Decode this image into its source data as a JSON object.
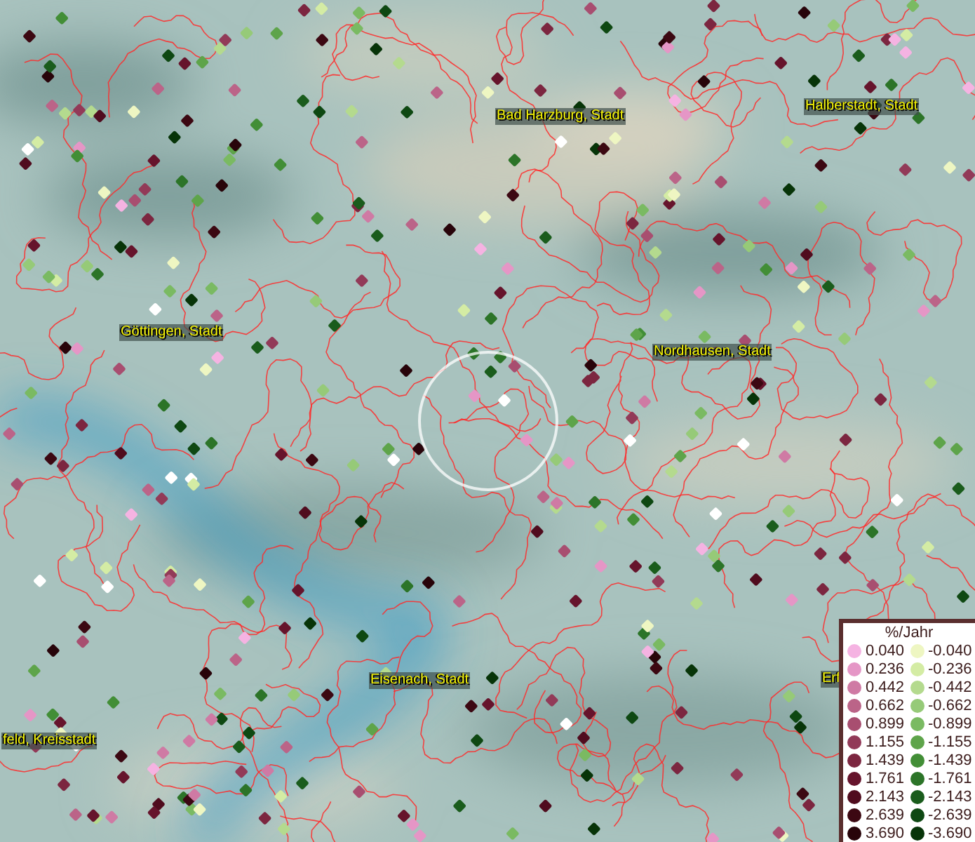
{
  "map_labels": [
    {
      "text": "Bad Harzburg, Stadt"
    },
    {
      "text": "Halberstadt, Stadt"
    },
    {
      "text": "Göttingen, Stadt"
    },
    {
      "text": "Nordhausen, Stadt"
    },
    {
      "text": "Eisenach, Stadt"
    },
    {
      "text": "feld, Kreisstadt"
    },
    {
      "text": "Erf"
    }
  ],
  "legend": {
    "title": "%/Jahr",
    "positive": [
      {
        "label": "0.040",
        "color": "#f5b3e2"
      },
      {
        "label": "0.236",
        "color": "#e596c6"
      },
      {
        "label": "0.442",
        "color": "#cf7aa4"
      },
      {
        "label": "0.662",
        "color": "#bb6488"
      },
      {
        "label": "0.899",
        "color": "#a84e70"
      },
      {
        "label": "1.155",
        "color": "#923a58"
      },
      {
        "label": "1.439",
        "color": "#7c2640"
      },
      {
        "label": "1.761",
        "color": "#66142c"
      },
      {
        "label": "2.143",
        "color": "#500c1e"
      },
      {
        "label": "2.639",
        "color": "#3c0812"
      },
      {
        "label": "3.690",
        "color": "#28040a"
      }
    ],
    "negative": [
      {
        "label": "-0.040",
        "color": "#eef6c2"
      },
      {
        "label": "-0.236",
        "color": "#d4eca4"
      },
      {
        "label": "-0.442",
        "color": "#b4da8e"
      },
      {
        "label": "-0.662",
        "color": "#96ca78"
      },
      {
        "label": "-0.899",
        "color": "#7aba62"
      },
      {
        "label": "-1.155",
        "color": "#5ea44a"
      },
      {
        "label": "-1.439",
        "color": "#428e36"
      },
      {
        "label": "-1.761",
        "color": "#2c7428"
      },
      {
        "label": "-2.143",
        "color": "#1a5c1c"
      },
      {
        "label": "-2.639",
        "color": "#0e4812"
      },
      {
        "label": "-3.690",
        "color": "#073408"
      }
    ]
  }
}
